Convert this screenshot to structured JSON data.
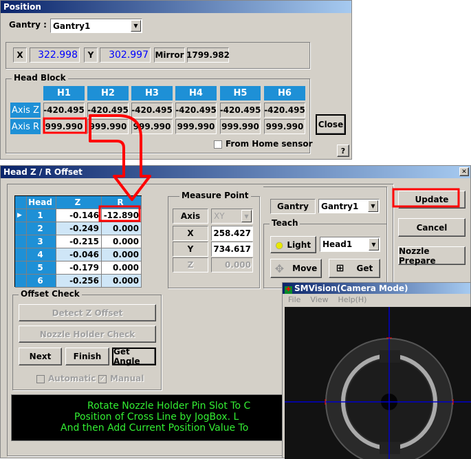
{
  "position": {
    "title": "Position",
    "gantry_label": "Gantry :",
    "gantry_value": "Gantry1",
    "x_label": "X",
    "x_value": "322.998",
    "y_label": "Y",
    "y_value": "302.997",
    "mirror_label": "Mirror",
    "mirror_value": "1799.982",
    "head_block_label": "Head Block",
    "heads": [
      "H1",
      "H2",
      "H3",
      "H4",
      "H5",
      "H6"
    ],
    "axis_z_label": "Axis Z",
    "axis_z": [
      "-420.495",
      "-420.495",
      "-420.495",
      "-420.495",
      "-420.495",
      "-420.495"
    ],
    "axis_r_label": "Axis R",
    "axis_r": [
      "999.990",
      "999.990",
      "999.990",
      "999.990",
      "999.990",
      "999.990"
    ],
    "close": "Close",
    "from_home": "From Home sensor",
    "help": "?"
  },
  "offset": {
    "title": "Head Z / R Offset",
    "close_x": "✕",
    "grid": {
      "headers": [
        "Head",
        "Z",
        "R"
      ],
      "rows": [
        [
          "1",
          "-0.146",
          "-12.890"
        ],
        [
          "2",
          "-0.249",
          "0.000"
        ],
        [
          "3",
          "-0.215",
          "0.000"
        ],
        [
          "4",
          "-0.046",
          "0.000"
        ],
        [
          "5",
          "-0.179",
          "0.000"
        ],
        [
          "6",
          "-0.256",
          "0.000"
        ]
      ]
    },
    "measure": {
      "label": "Measure Point",
      "axis_label": "Axis",
      "axis_value": "XY",
      "x_label": "X",
      "x_value": "258.427",
      "y_label": "Y",
      "y_value": "734.617",
      "z_label": "Z",
      "z_value": "0.000"
    },
    "gantry_label": "Gantry",
    "gantry_value": "Gantry1",
    "teach_label": "Teach",
    "light": "Light",
    "head_value": "Head1",
    "move": "Move",
    "get": "Get",
    "update": "Update",
    "cancel": "Cancel",
    "nozzle_prepare": "Nozzle Prepare",
    "offset_check": {
      "label": "Offset Check",
      "detect": "Detect Z Offset",
      "nozzle_holder": "Nozzle Holder Check",
      "next": "Next",
      "finish": "Finish",
      "get_angle": "Get Angle",
      "automatic": "Automatic",
      "manual": "Manual"
    },
    "message": [
      "Rotate Nozzle Holder Pin Slot To C",
      "Position of Cross Line by JogBox.  L",
      "And then Add Current Position Value To"
    ]
  },
  "camera": {
    "title": "SMVision(Camera Mode)",
    "menu": [
      "File",
      "View",
      "Help(H)"
    ]
  },
  "colors": {
    "header_blue": "#1e90d6",
    "value_blue": "#0000ff",
    "annotation_red": "#ff0000",
    "message_green": "#33ee33"
  }
}
